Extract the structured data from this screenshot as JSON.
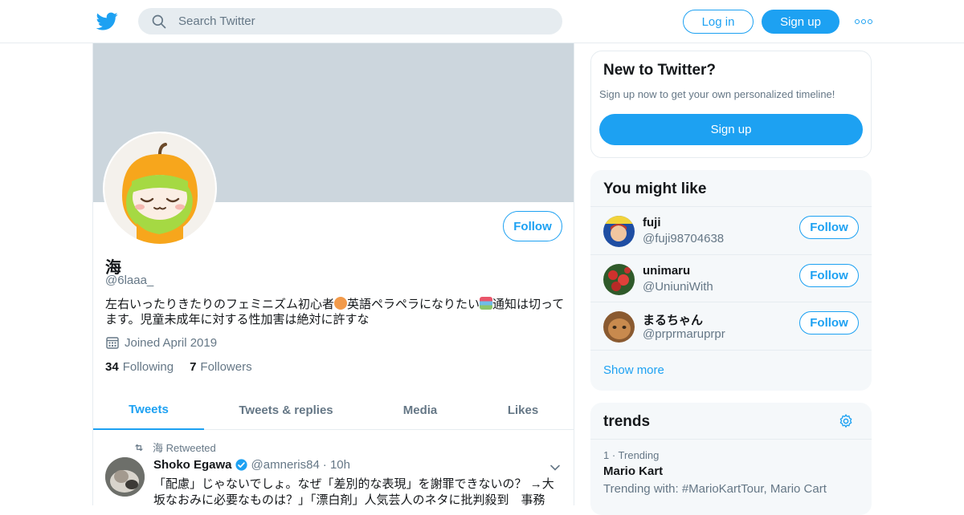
{
  "header": {
    "search_placeholder": "Search Twitter",
    "login_label": "Log in",
    "signup_label": "Sign up"
  },
  "profile": {
    "name": "海",
    "handle": "@6laaa_",
    "bio_part1": "左右いったりきたりのフェミニズム初心者",
    "bio_part2": "英語ペラペラになりたい",
    "bio_part3": "通知は切ってます。児童未成年に対する性加害は絶対に許すな",
    "joined": "Joined April 2019",
    "following_count": "34",
    "following_label": "Following",
    "followers_count": "7",
    "followers_label": "Followers",
    "follow_label": "Follow"
  },
  "tabs": [
    {
      "label": "Tweets",
      "active": true
    },
    {
      "label": "Tweets & replies",
      "active": false
    },
    {
      "label": "Media",
      "active": false
    },
    {
      "label": "Likes",
      "active": false
    }
  ],
  "tweet": {
    "retweet_note": "海 Retweeted",
    "author": "Shoko Egawa",
    "handle": "@amneris84",
    "time": "· 10h",
    "text": "「配慮」じゃないでしょ。なぜ「差別的な表現」を謝罪できないの？ →大坂なおみに必要なものは？」「漂白剤」人気芸人のネタに批判殺到　事務"
  },
  "sidebar": {
    "new_title": "New to Twitter?",
    "new_text": "Sign up now to get your own personalized timeline!",
    "new_signup": "Sign up",
    "like_title": "You might like",
    "suggestions": [
      {
        "name": "fuji",
        "handle": "@fuji98704638",
        "follow": "Follow"
      },
      {
        "name": "unimaru",
        "handle": "@UniuniWith",
        "follow": "Follow"
      },
      {
        "name": "まるちゃん",
        "handle": "@prprmaruprpr",
        "follow": "Follow"
      }
    ],
    "show_more": "Show more",
    "trends_title": "trends",
    "trend": {
      "meta": "1 · Trending",
      "name": "Mario Kart",
      "with": "Trending with: #MarioKartTour, Mario Cart"
    }
  },
  "icons": {
    "logo": "twitter-bird-icon",
    "search": "search-icon",
    "more": "more-dots-icon",
    "calendar": "calendar-icon",
    "retweet": "retweet-icon",
    "verified": "verified-badge-icon",
    "caret": "chevron-down-icon",
    "gear": "gear-icon"
  },
  "colors": {
    "accent": "#1da1f2",
    "banner": "#ccd6dd",
    "muted": "#657786"
  }
}
